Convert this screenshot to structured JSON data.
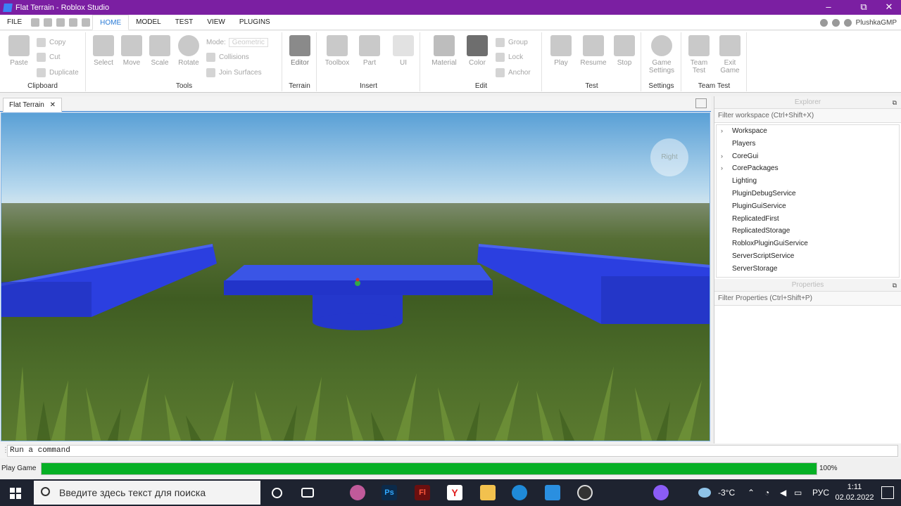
{
  "window": {
    "title": "Flat Terrain - Roblox Studio",
    "controls": [
      "–",
      "⧉",
      "✕"
    ]
  },
  "menu": {
    "tabs": [
      "FILE",
      "HOME",
      "MODEL",
      "TEST",
      "VIEW",
      "PLUGINS"
    ],
    "active": "HOME",
    "user": "PlushkaGMP"
  },
  "ribbon": {
    "clipboard": {
      "name": "Clipboard",
      "paste": "Paste",
      "copy": "Copy",
      "cut": "Cut",
      "duplicate": "Duplicate"
    },
    "tools": {
      "name": "Tools",
      "select": "Select",
      "move": "Move",
      "scale": "Scale",
      "rotate": "Rotate",
      "mode_label": "Mode:",
      "mode_value": "Geometric",
      "collisions": "Collisions",
      "join_surfaces": "Join Surfaces"
    },
    "terrain": {
      "name": "Terrain",
      "editor": "Editor"
    },
    "insert": {
      "name": "Insert",
      "toolbox": "Toolbox",
      "part": "Part",
      "ui": "UI"
    },
    "edit": {
      "name": "Edit",
      "material": "Material",
      "color": "Color",
      "group": "Group",
      "lock": "Lock",
      "anchor": "Anchor"
    },
    "test": {
      "name": "Test",
      "play": "Play",
      "resume": "Resume",
      "stop": "Stop"
    },
    "settings": {
      "name": "Settings",
      "game_settings_1": "Game",
      "game_settings_2": "Settings"
    },
    "team_test": {
      "name": "Team Test",
      "team_test_1": "Team",
      "team_test_2": "Test",
      "exit_game_1": "Exit",
      "exit_game_2": "Game"
    }
  },
  "document_tab": {
    "label": "Flat Terrain",
    "close": "✕"
  },
  "viewport": {
    "gizmo_label": "Right"
  },
  "explorer": {
    "title": "Explorer",
    "filter": "Filter workspace (Ctrl+Shift+X)",
    "items": [
      {
        "label": "Workspace",
        "expandable": "›"
      },
      {
        "label": "Players",
        "expandable": ""
      },
      {
        "label": "CoreGui",
        "expandable": "›"
      },
      {
        "label": "CorePackages",
        "expandable": "›"
      },
      {
        "label": "Lighting",
        "expandable": ""
      },
      {
        "label": "PluginDebugService",
        "expandable": ""
      },
      {
        "label": "PluginGuiService",
        "expandable": ""
      },
      {
        "label": "ReplicatedFirst",
        "expandable": ""
      },
      {
        "label": "ReplicatedStorage",
        "expandable": ""
      },
      {
        "label": "RobloxPluginGuiService",
        "expandable": ""
      },
      {
        "label": "ServerScriptService",
        "expandable": ""
      },
      {
        "label": "ServerStorage",
        "expandable": ""
      }
    ]
  },
  "properties": {
    "title": "Properties",
    "filter": "Filter Properties (Ctrl+Shift+P)"
  },
  "command_bar": {
    "placeholder": "Run a command"
  },
  "progress": {
    "label": "Play Game",
    "percent_text": "100%",
    "value": 1.0
  },
  "taskbar": {
    "search_placeholder": "Введите здесь текст для поиска",
    "weather": "-3°C",
    "language": "РУС",
    "time": "1:11",
    "date": "02.02.2022"
  },
  "colors": {
    "accent": "#7b1fa2",
    "tab_active": "#2a7bd6",
    "progress": "#06b025",
    "part_blue": "#2b3fe0"
  }
}
